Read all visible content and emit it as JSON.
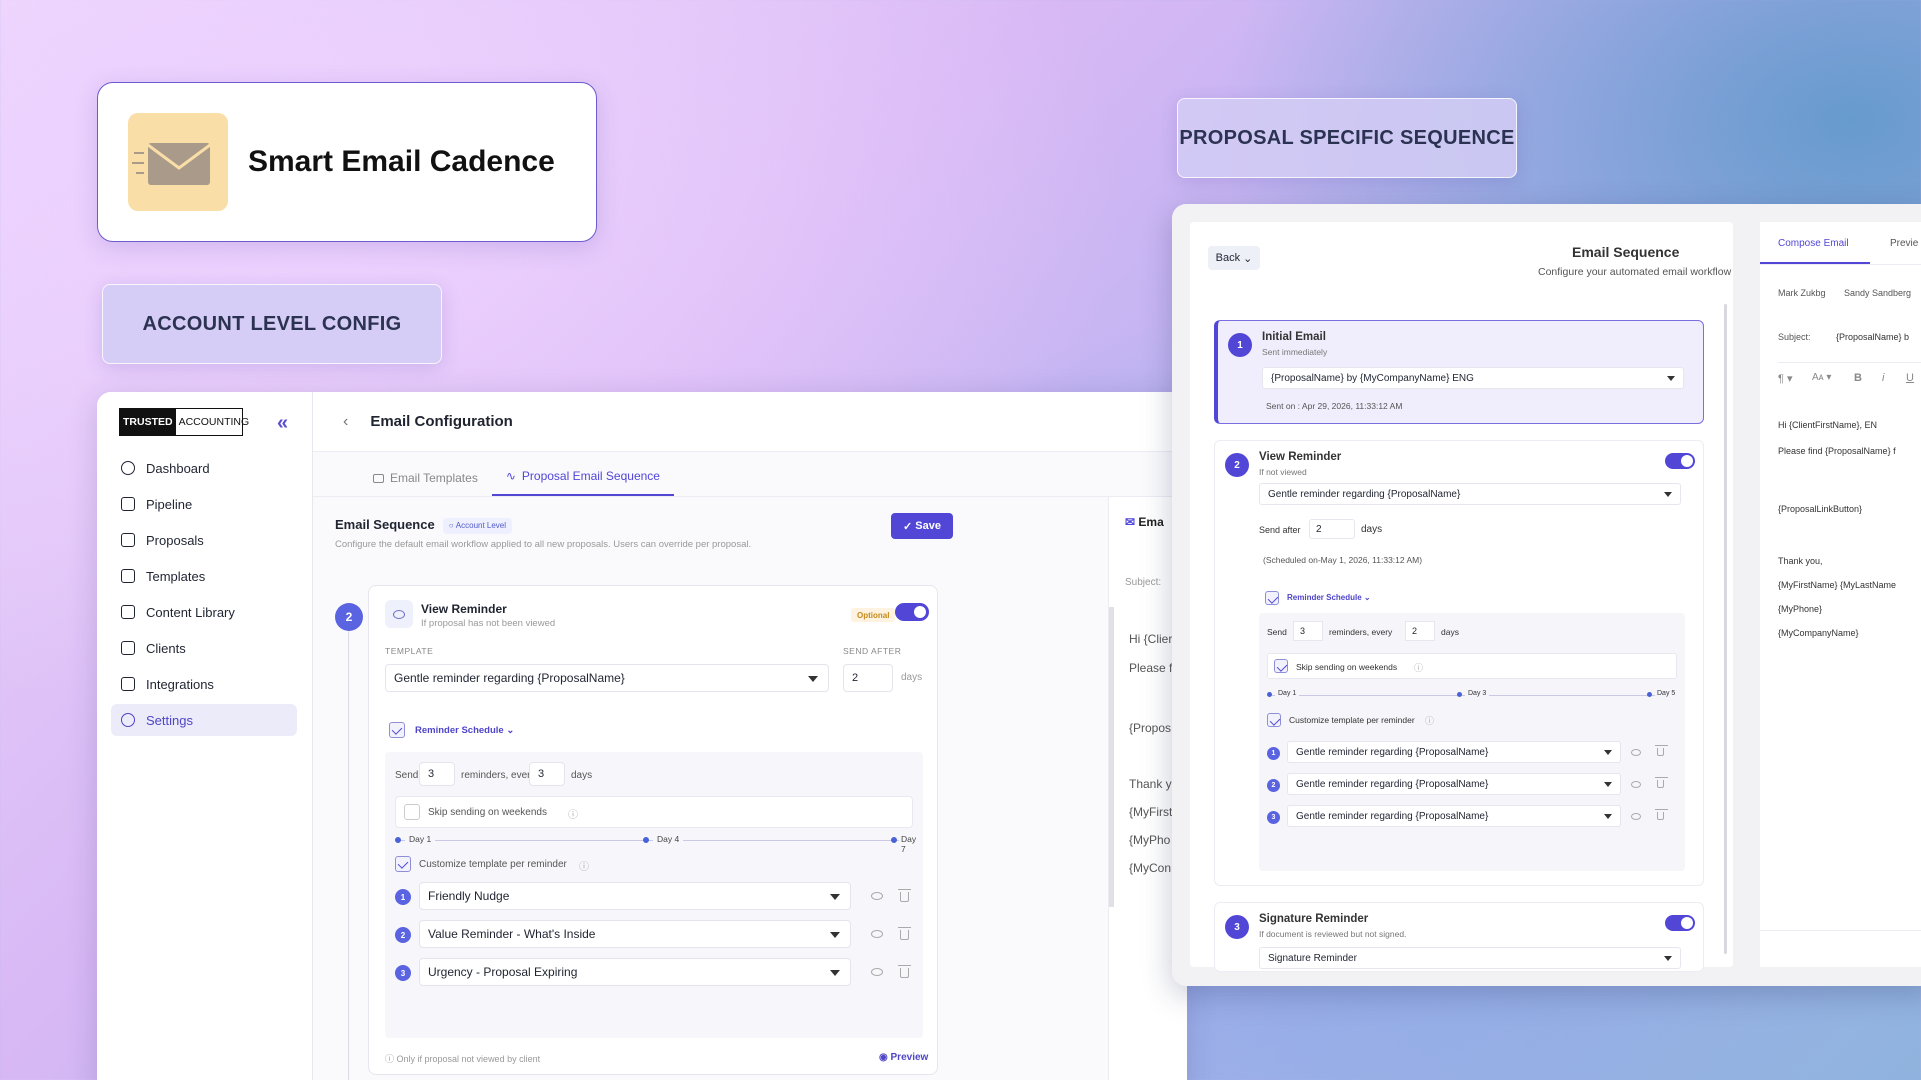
{
  "hero": {
    "title": "Smart Email Cadence",
    "icon": "envelope-icon"
  },
  "labels": {
    "account": "ACCOUNT LEVEL CONFIG",
    "proposal": "PROPOSAL SPECIFIC SEQUENCE"
  },
  "left": {
    "logo": {
      "bold": "TRUSTED",
      "rest": "ACCOUNTING"
    },
    "nav": [
      "Dashboard",
      "Pipeline",
      "Proposals",
      "Templates",
      "Content Library",
      "Clients",
      "Integrations",
      "Settings"
    ],
    "page_title": "Email Configuration",
    "tabs": [
      "Email Templates",
      "Proposal Email Sequence"
    ],
    "seq_title": "Email Sequence",
    "badge": "Account Level",
    "seq_desc": "Configure the default email workflow applied to all new proposals. Users can override per proposal.",
    "save": "Save",
    "step": {
      "num": "2",
      "title": "View Reminder",
      "sub": "If proposal has not been viewed",
      "optional": "Optional",
      "template_label": "TEMPLATE",
      "send_after_label": "SEND AFTER",
      "template": "Gentle reminder regarding {ProposalName}",
      "send_after": "2",
      "days": "days",
      "schedule": "Reminder Schedule",
      "send": "Send",
      "count": "3",
      "every": "reminders, every",
      "interval": "3",
      "skip": "Skip sending on weekends",
      "timeline": [
        "Day 1",
        "Day 4",
        "Day 7"
      ],
      "customize": "Customize template per reminder",
      "reminders": [
        {
          "n": "1",
          "name": "Friendly Nudge"
        },
        {
          "n": "2",
          "name": "Value Reminder - What's Inside"
        },
        {
          "n": "3",
          "name": "Urgency - Proposal Expiring"
        }
      ],
      "footnote": "Only if proposal not viewed by client",
      "preview": "Preview"
    },
    "preview_pane": {
      "header": "Ema",
      "subject": "Subject:",
      "lines": [
        "Hi {Clier",
        "Please f",
        "{Propos",
        "Thank y",
        "{MyFirst",
        "{MyPho",
        "{MyCon"
      ]
    }
  },
  "right": {
    "back": "Back",
    "title": "Email Sequence",
    "subtitle": "Configure your automated email workflow",
    "s1": {
      "n": "1",
      "title": "Initial Email",
      "sub": "Sent immediately",
      "template": "{ProposalName} by {MyCompanyName} ENG",
      "sent": "Sent on : Apr 29, 2026, 11:33:12 AM"
    },
    "s2": {
      "n": "2",
      "title": "View Reminder",
      "sub": "If not viewed",
      "template": "Gentle reminder regarding {ProposalName}",
      "send_after": "Send after",
      "value": "2",
      "days": "days",
      "scheduled": "(Scheduled on-May 1, 2026, 11:33:12 AM)",
      "schedule": "Reminder Schedule",
      "send": "Send",
      "count": "3",
      "every": "reminders, every",
      "interval": "2",
      "skip": "Skip sending on weekends",
      "timeline": [
        "Day 1",
        "Day 3",
        "Day 5"
      ],
      "customize": "Customize template per reminder",
      "reminders": [
        "Gentle reminder regarding {ProposalName}",
        "Gentle reminder regarding {ProposalName}",
        "Gentle reminder regarding {ProposalName}"
      ]
    },
    "s3": {
      "n": "3",
      "title": "Signature Reminder",
      "sub": "If document is reviewed but not signed.",
      "template": "Signature Reminder"
    },
    "compose": {
      "tabs": [
        "Compose Email",
        "Previe"
      ],
      "recipients": [
        "Mark Zukbg",
        "Sandy Sandberg"
      ],
      "subject_label": "Subject:",
      "subject": "{ProposalName} b",
      "body": [
        "Hi {ClientFirstName},  EN",
        "Please find {ProposalName} f",
        "{ProposalLinkButton}",
        "Thank you,",
        "{MyFirstName}  {MyLastName",
        "{MyPhone}",
        "{MyCompanyName}"
      ]
    }
  }
}
